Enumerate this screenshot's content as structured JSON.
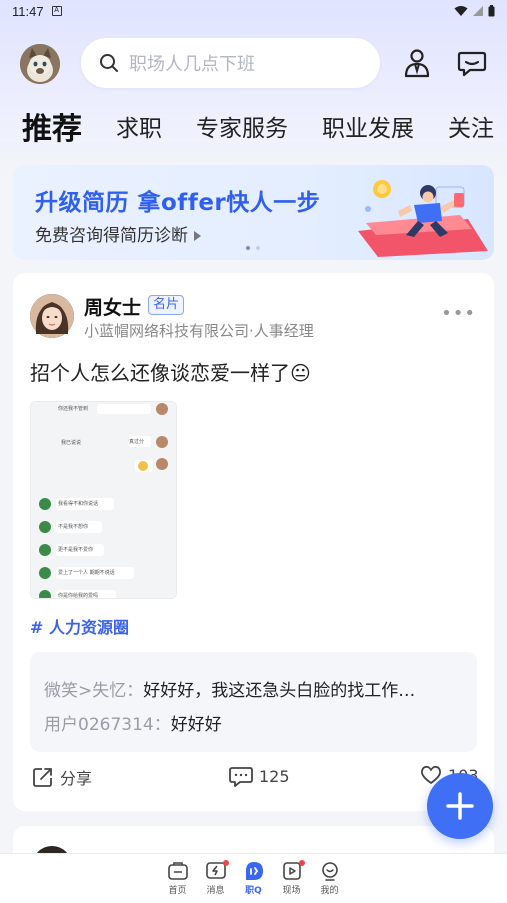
{
  "status_bar": {
    "time": "11:47"
  },
  "header": {
    "search_placeholder": "职场人几点下班"
  },
  "tabs": [
    {
      "label": "推荐",
      "active": true
    },
    {
      "label": "求职",
      "active": false
    },
    {
      "label": "专家服务",
      "active": false
    },
    {
      "label": "职业发展",
      "active": false
    },
    {
      "label": "关注",
      "active": false
    }
  ],
  "banner": {
    "title": "升级简历 拿offer快人一步",
    "subtitle": "免费咨询得简历诊断"
  },
  "post": {
    "author": "周女士",
    "badge": "名片",
    "company": "小蓝帽网络科技有限公司·人事经理",
    "text": "招个人怎么还像谈恋爱一样了😐",
    "topic": "# 人力资源圈",
    "comments": [
      {
        "user": "微笑>失忆：",
        "text": "好好好，我这还急头白脸的找工作…"
      },
      {
        "user": "用户0267314：",
        "text": "好好好"
      }
    ],
    "actions": {
      "share_label": "分享",
      "comment_count": "125",
      "like_count": "103"
    },
    "chat_image": {
      "lines": [
        "你还我不管到",
        "我已说说",
        "真过分",
        "我看得不和你说话",
        "不是我不想你",
        "更不是我不爱你",
        "爱上了一个人 期期不说话",
        "你是你给我的爱吗"
      ]
    }
  },
  "bottom_nav": [
    {
      "label": "首页",
      "icon": "home-icon",
      "active": false,
      "dot": false
    },
    {
      "label": "消息",
      "icon": "message-icon",
      "active": false,
      "dot": true
    },
    {
      "label": "职Q",
      "icon": "zhiq-icon",
      "active": true,
      "dot": false
    },
    {
      "label": "现场",
      "icon": "live-icon",
      "active": false,
      "dot": true
    },
    {
      "label": "我的",
      "icon": "profile-icon",
      "active": false,
      "dot": false
    }
  ],
  "colors": {
    "accent": "#3f6ff5",
    "topic": "#3d63ea",
    "badge_dot": "#f0444c"
  }
}
